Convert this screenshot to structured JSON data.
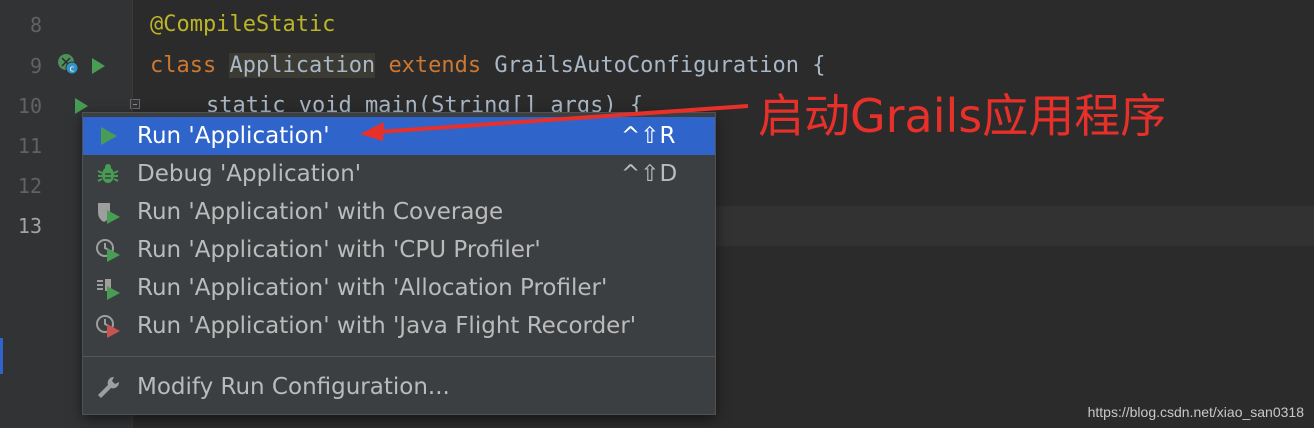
{
  "gutter": {
    "line_numbers": [
      "8",
      "9",
      "10",
      "11",
      "12",
      "13"
    ]
  },
  "editor": {
    "line8": {
      "annotation": "@CompileStatic"
    },
    "line9": {
      "kw_class": "class",
      "class_name": "Application",
      "kw_extends": "extends",
      "parent": "GrailsAutoConfiguration {"
    },
    "line10": {
      "text": "static void main(String[] args) {"
    }
  },
  "run_menu": {
    "items": [
      {
        "label": "Run 'Application'",
        "shortcut": "^⇧R",
        "icon": "run-icon"
      },
      {
        "label": "Debug 'Application'",
        "shortcut": "^⇧D",
        "icon": "debug-icon"
      },
      {
        "label": "Run 'Application' with Coverage",
        "icon": "coverage-icon"
      },
      {
        "label": "Run 'Application' with 'CPU Profiler'",
        "icon": "cpu-profiler-icon"
      },
      {
        "label": "Run 'Application' with 'Allocation Profiler'",
        "icon": "allocation-profiler-icon"
      },
      {
        "label": "Run 'Application' with 'Java Flight Recorder'",
        "icon": "flight-recorder-icon"
      },
      {
        "label": "Modify Run Configuration...",
        "icon": "wrench-icon"
      }
    ]
  },
  "annotation_text": "启动Grails应用程序",
  "watermark": "https://blog.csdn.net/xiao_san0318",
  "colors": {
    "accent": "#2f65ca",
    "run_green": "#499c54",
    "annotation_red": "#e8302a"
  }
}
